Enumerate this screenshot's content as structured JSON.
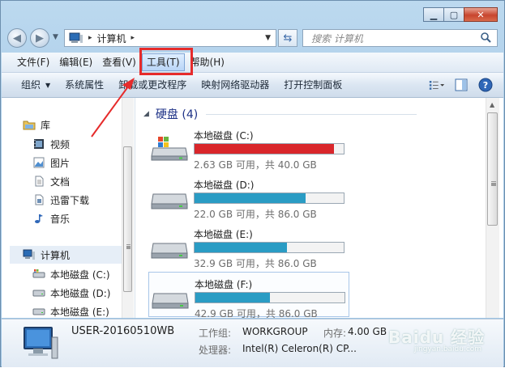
{
  "window": {
    "minimize": "▁",
    "maximize": "▢",
    "close": "✕"
  },
  "address": {
    "crumb": "计算机",
    "sep": "▸",
    "sep2": "▸"
  },
  "search": {
    "placeholder": "搜索 计算机"
  },
  "menu": [
    "文件(F)",
    "编辑(E)",
    "查看(V)",
    "工具(T)",
    "帮助(H)"
  ],
  "toolbar": {
    "organize": "组织",
    "items": [
      "系统属性",
      "卸载或更改程序",
      "映射网络驱动器",
      "打开控制面板"
    ]
  },
  "nav": {
    "library": "库",
    "lib_items": [
      "视频",
      "图片",
      "文档",
      "迅雷下载",
      "音乐"
    ],
    "computer": "计算机",
    "drives": [
      "本地磁盘 (C:)",
      "本地磁盘 (D:)",
      "本地磁盘 (E:)"
    ]
  },
  "content": {
    "group_title": "硬盘 (4)",
    "drives": [
      {
        "name": "本地磁盘 (C:)",
        "free": "2.63 GB 可用，共 40.0 GB",
        "used_fraction": 0.934,
        "color": "#d9262b"
      },
      {
        "name": "本地磁盘 (D:)",
        "free": "22.0 GB 可用，共 86.0 GB",
        "used_fraction": 0.744,
        "color": "#2a9cc4"
      },
      {
        "name": "本地磁盘 (E:)",
        "free": "32.9 GB 可用，共 86.0 GB",
        "used_fraction": 0.617,
        "color": "#2a9cc4"
      },
      {
        "name": "本地磁盘 (F:)",
        "free": "42.9 GB 可用，共 86.0 GB",
        "used_fraction": 0.501,
        "color": "#2a9cc4"
      }
    ]
  },
  "details": {
    "host": "USER-20160510WB",
    "workgroup_label": "工作组:",
    "workgroup": "WORKGROUP",
    "memory_label": "内存:",
    "memory": "4.00 GB",
    "cpu_label": "处理器:",
    "cpu": "Intel(R) Celeron(R) CP..."
  },
  "watermark": {
    "logo": "Baidu 经验",
    "sub": "jingyan.baidu.com"
  },
  "colors": {
    "highlight": "#e62b2b",
    "accent": "#1e3287"
  }
}
